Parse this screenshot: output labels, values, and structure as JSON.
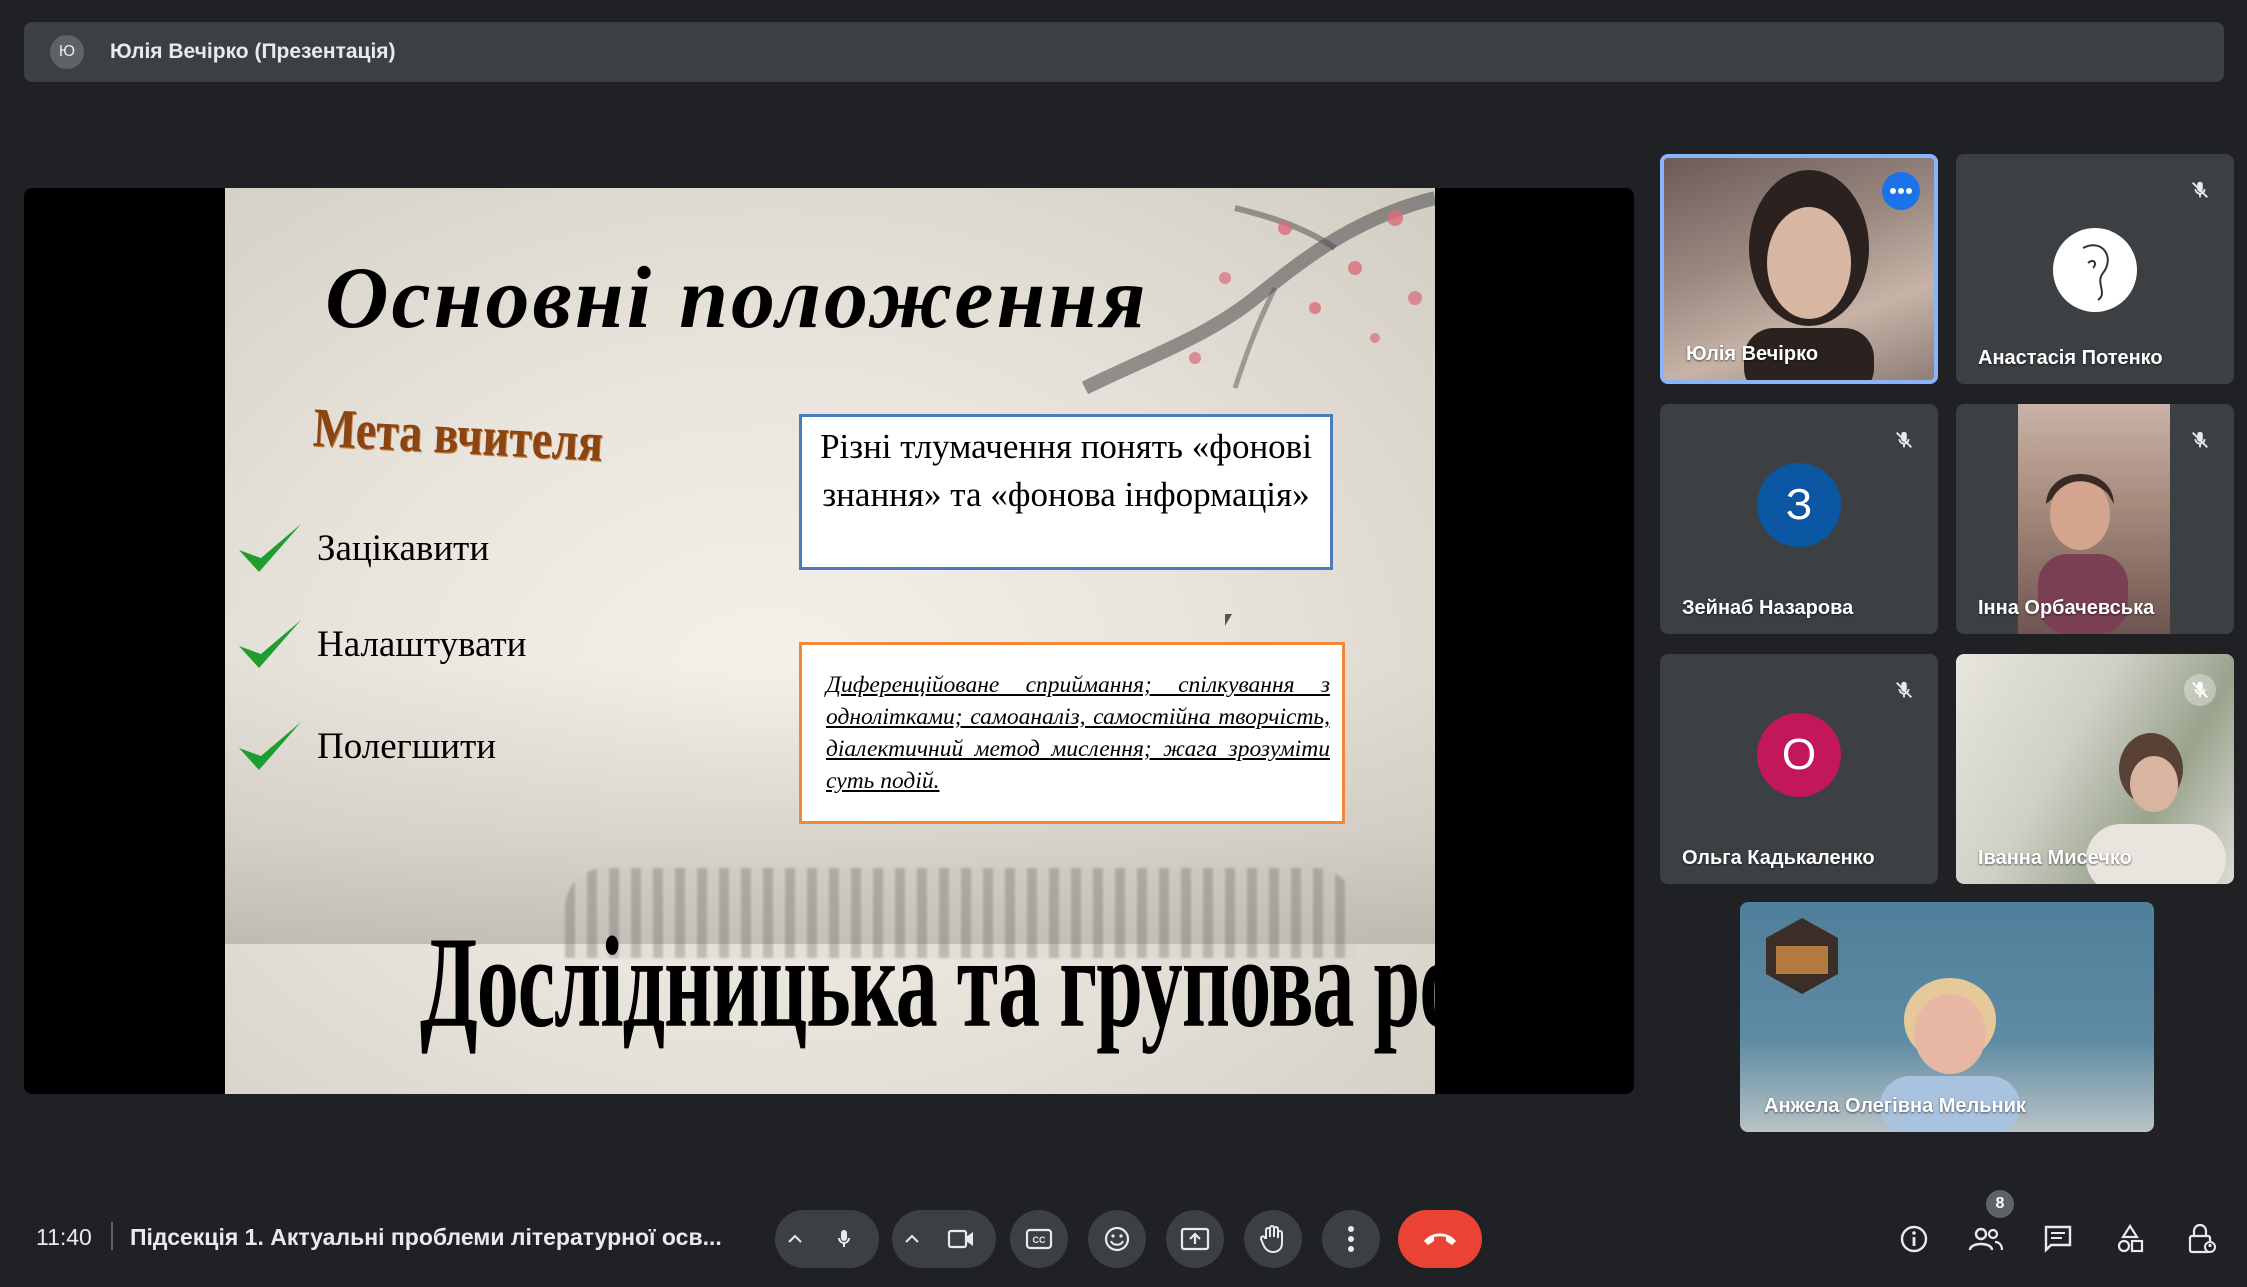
{
  "presenter_banner": {
    "avatar_letter": "Ю",
    "title": "Юлія Вечірко (Презентація)"
  },
  "slide": {
    "title": "Основні положення",
    "goal_heading": "Мета вчителя",
    "goals": [
      "Зацікавити",
      "Налаштувати",
      "Полегшити"
    ],
    "blue_box_text": "Різні тлумачення понять «фонові знання» та «фонова інформація»",
    "orange_box_text": "Диференційоване сприймання; спілкування з однолітками; самоаналіз, самостійна творчість, діалектичний метод мислення; жага зрозуміти суть подій.",
    "bottom_title": "Дослідницька та групова робота"
  },
  "participants": [
    {
      "name": "Юлія Вечірко",
      "type": "video",
      "muted": false,
      "active": true
    },
    {
      "name": "Анастасія Потенко",
      "type": "avatar-image",
      "muted": true
    },
    {
      "name": "Зейнаб Назарова",
      "type": "letter",
      "letter": "З",
      "color": "#0b57a4",
      "muted": true
    },
    {
      "name": "Інна Орбачевська",
      "type": "video",
      "muted": true
    },
    {
      "name": "Ольга Кадькаленко",
      "type": "letter",
      "letter": "О",
      "color": "#c2185b",
      "muted": true
    },
    {
      "name": "Іванна Мисечко",
      "type": "video",
      "muted": true
    },
    {
      "name": "Анжела Олегівна Мельник",
      "type": "video",
      "muted": false
    }
  ],
  "bottom_bar": {
    "time": "11:40",
    "meeting_title": "Підсекція 1. Актуальні проблеми літературної осв...",
    "participants_count": "8"
  },
  "colors": {
    "background": "#202124",
    "end_call": "#ea4335",
    "active_border": "#8ab4f8"
  }
}
